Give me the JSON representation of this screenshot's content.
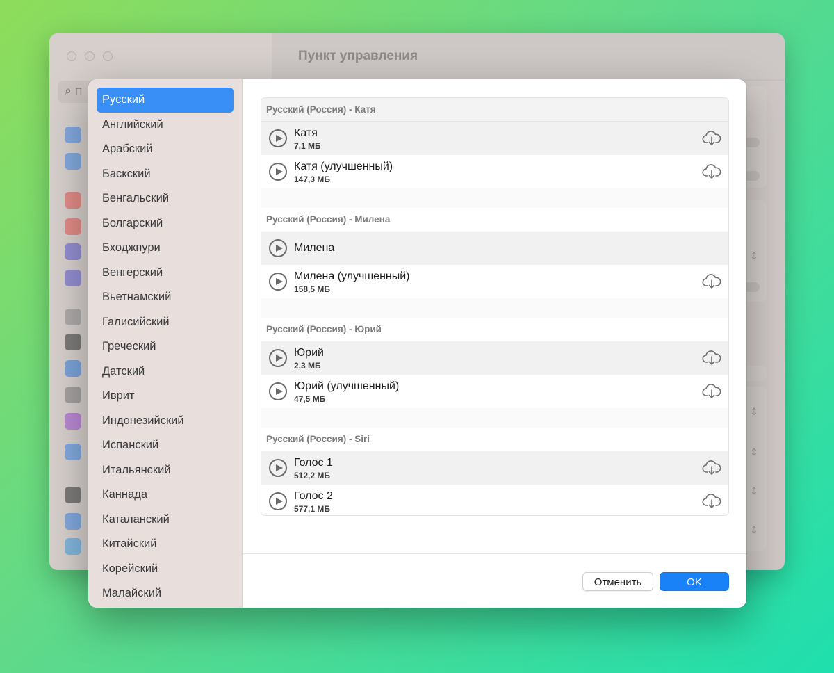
{
  "background_window": {
    "title": "Пункт управления",
    "search_placeholder": "П"
  },
  "languages": [
    "Русский",
    "Английский",
    "Арабский",
    "Баскский",
    "Бенгальский",
    "Болгарский",
    "Бходжпури",
    "Венгерский",
    "Вьетнамский",
    "Галисийский",
    "Греческий",
    "Датский",
    "Иврит",
    "Индонезийский",
    "Испанский",
    "Итальянский",
    "Каннада",
    "Каталанский",
    "Китайский",
    "Корейский",
    "Малайский"
  ],
  "selected_language": "Русский",
  "voice_groups": [
    {
      "header": "Русский (Россия) - Катя",
      "voices": [
        {
          "name": "Катя",
          "size": "7,1 МБ",
          "downloadable": true
        },
        {
          "name": "Катя (улучшенный)",
          "size": "147,3 МБ",
          "downloadable": true
        }
      ]
    },
    {
      "header": "Русский (Россия) - Милена",
      "voices": [
        {
          "name": "Милена",
          "size": "",
          "downloadable": false
        },
        {
          "name": "Милена (улучшенный)",
          "size": "158,5 МБ",
          "downloadable": true
        }
      ]
    },
    {
      "header": "Русский (Россия) - Юрий",
      "voices": [
        {
          "name": "Юрий",
          "size": "2,3 МБ",
          "downloadable": true
        },
        {
          "name": "Юрий (улучшенный)",
          "size": "47,5 МБ",
          "downloadable": true
        }
      ]
    },
    {
      "header": "Русский (Россия) - Siri",
      "voices": [
        {
          "name": "Голос 1",
          "size": "512,2 МБ",
          "downloadable": true
        },
        {
          "name": "Голос 2",
          "size": "577,1 МБ",
          "downloadable": true
        }
      ]
    }
  ],
  "footer": {
    "cancel_label": "Отменить",
    "ok_label": "OK"
  },
  "colors": {
    "accent": "#1a82f7",
    "selection": "#3a8ff6"
  },
  "icons": {
    "play": "play-circle-icon",
    "download": "icloud-download-icon"
  }
}
